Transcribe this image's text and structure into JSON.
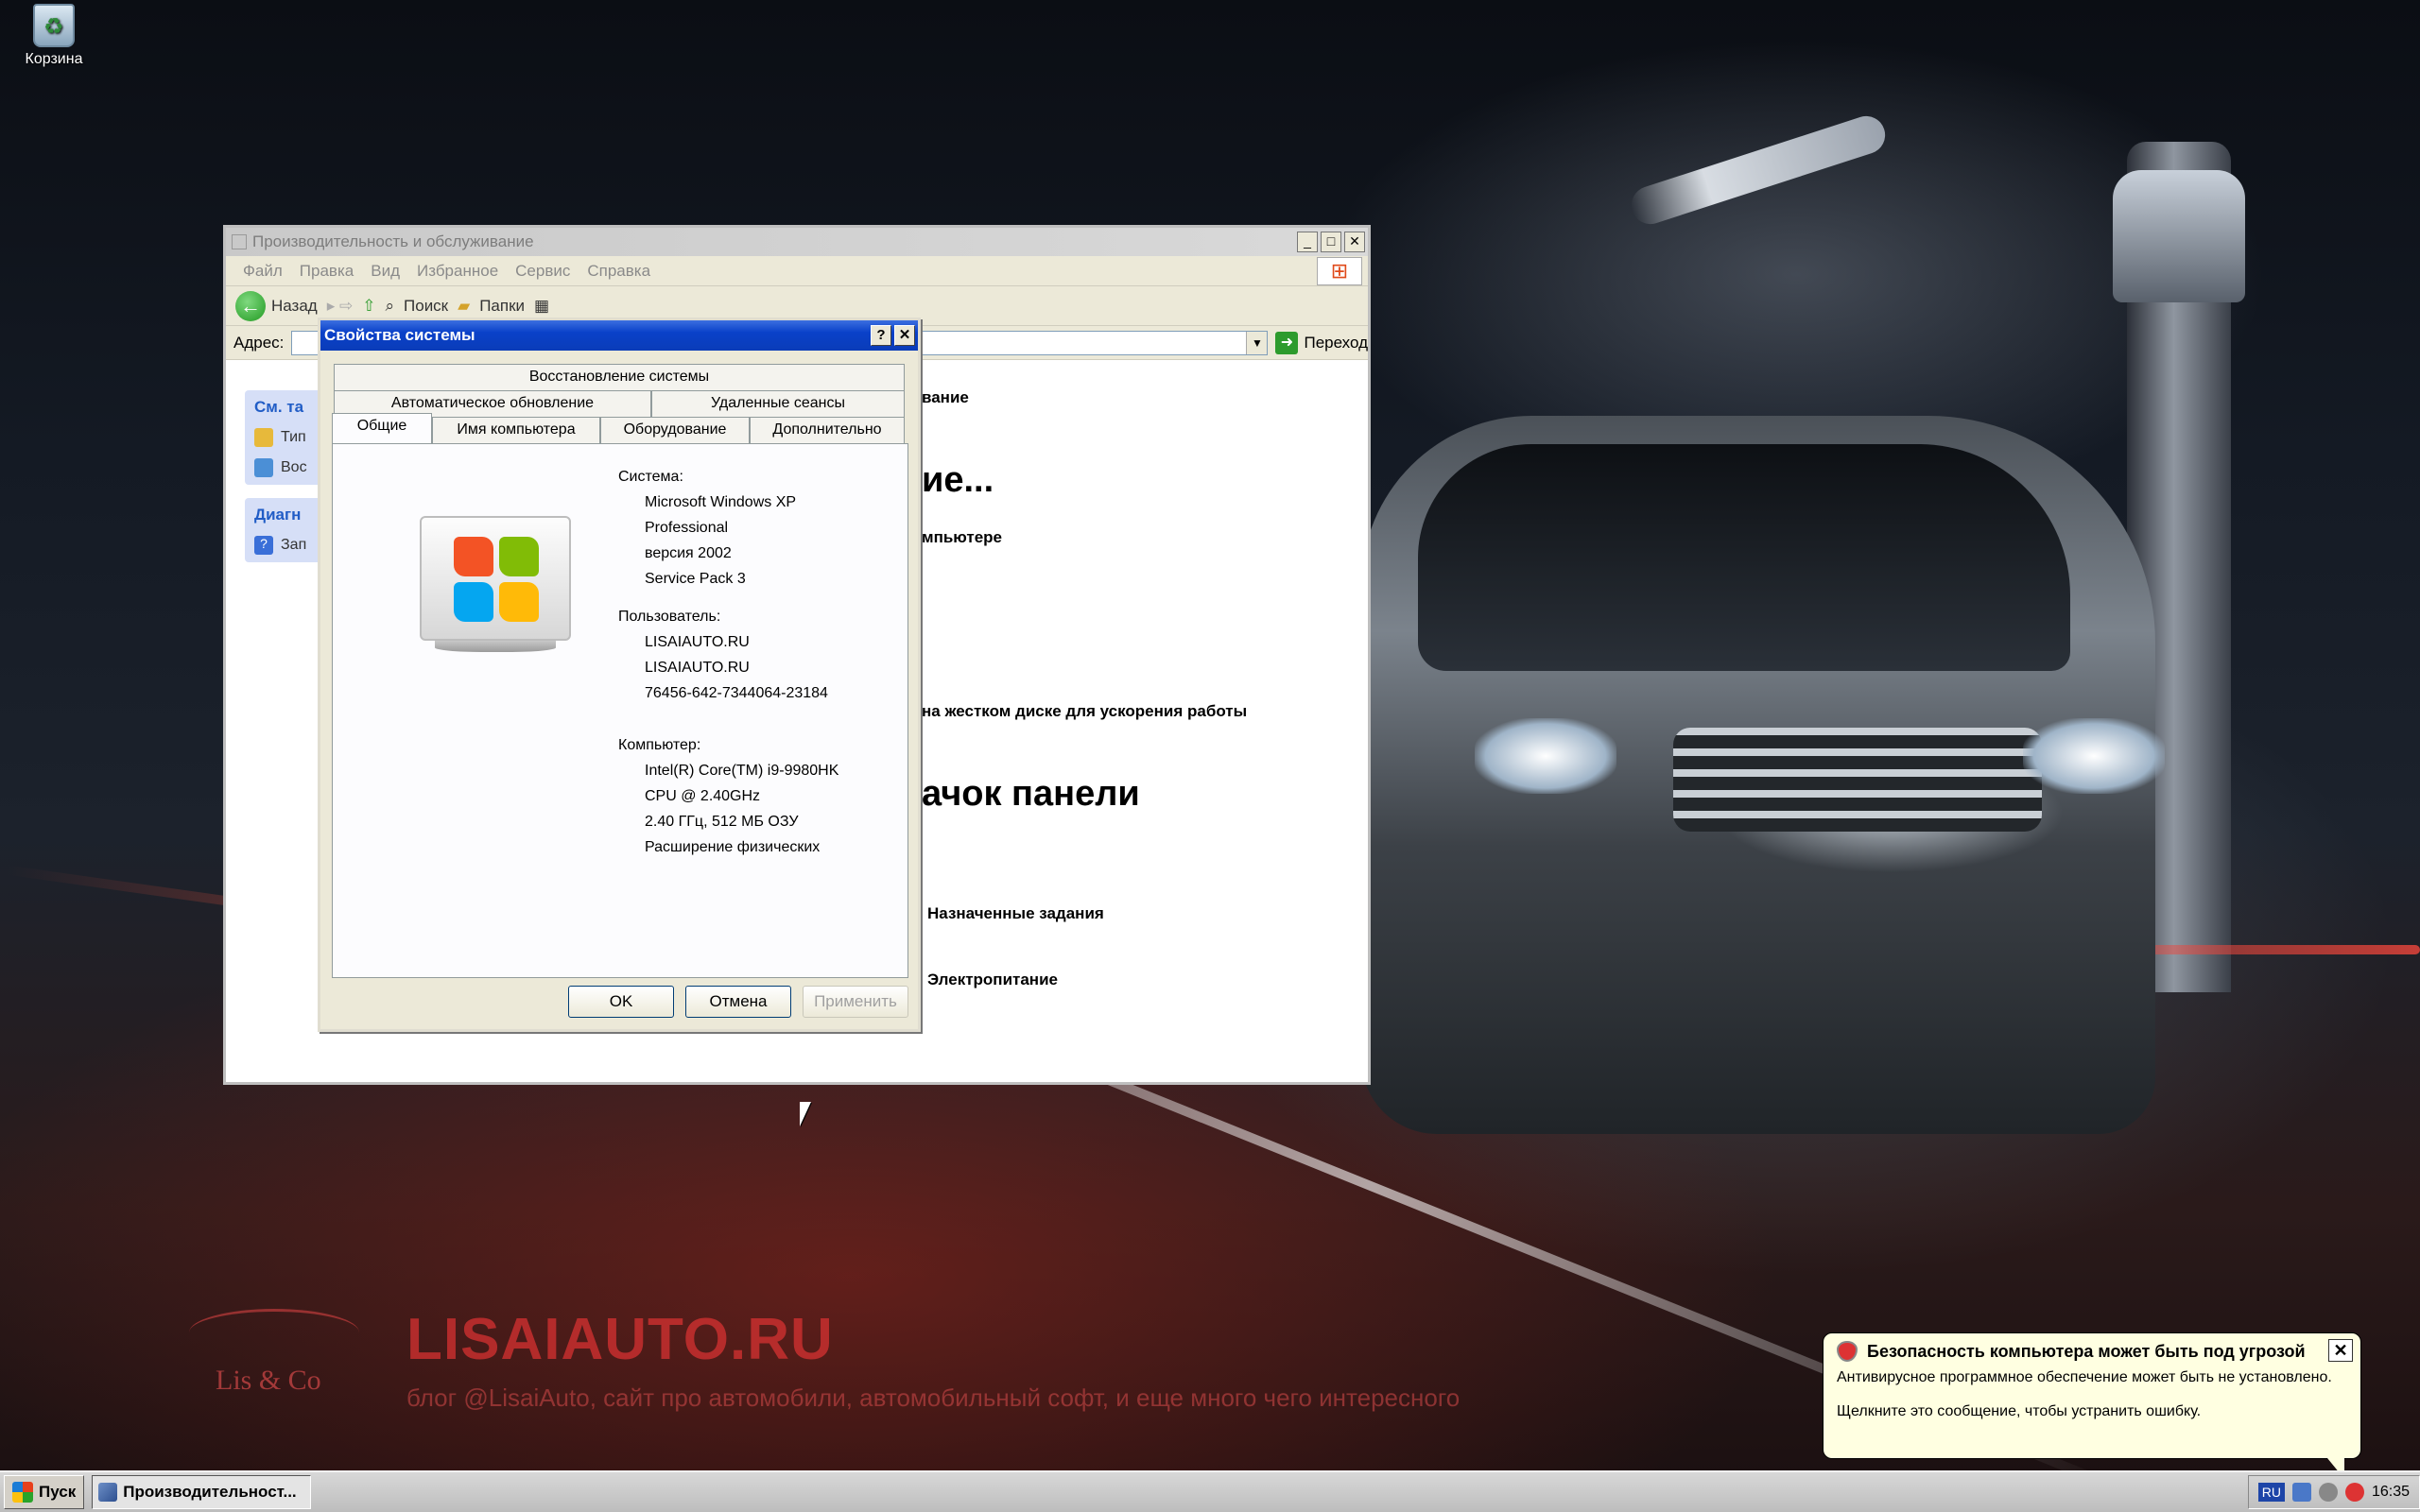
{
  "desktop": {
    "recycle_bin_label": "Корзина",
    "watermark": {
      "logo_text": "Lis & Co",
      "title": "LISAIAUTO.RU",
      "subtitle": "блог @LisaiAuto, сайт про автомобили, автомобильный софт, и еще много чего интересного"
    }
  },
  "explorer": {
    "title": "Производительность и обслуживание",
    "menu": [
      "Файл",
      "Правка",
      "Вид",
      "Избранное",
      "Сервис",
      "Справка"
    ],
    "toolbar": {
      "back": "Назад",
      "search": "Поиск",
      "folders": "Папки"
    },
    "address_label": "Адрес:",
    "go_label": "Переход",
    "side": {
      "see_also_head": "См. та",
      "see_also_items": [
        "Тип",
        "Вос"
      ],
      "diag_head": "Диагн",
      "diag_items": [
        "Зап"
      ]
    },
    "content": {
      "line1": "вание",
      "heading1": "ие...",
      "line2": "мпьютере",
      "line3": "на жестком диске для ускорения работы",
      "heading2": "ачок панели",
      "task1": "Назначенные задания",
      "task2": "Электропитание"
    }
  },
  "dialog": {
    "title": "Свойства системы",
    "help_btn": "?",
    "close_btn": "✕",
    "tabs_row1": [
      "Восстановление системы"
    ],
    "tabs_row2": [
      "Автоматическое обновление",
      "Удаленные сеансы"
    ],
    "tabs_row3": [
      "Общие",
      "Имя компьютера",
      "Оборудование",
      "Дополнительно"
    ],
    "system_label": "Система:",
    "system": [
      "Microsoft Windows XP",
      "Professional",
      "версия 2002",
      "Service Pack 3"
    ],
    "user_label": "Пользователь:",
    "user": [
      "LISAIAUTO.RU",
      "LISAIAUTO.RU",
      "76456-642-7344064-23184"
    ],
    "computer_label": "Компьютер:",
    "computer": [
      "Intel(R) Core(TM) i9-9980HK",
      "CPU @ 2.40GHz",
      "2.40 ГГц, 512 МБ ОЗУ",
      "Расширение физических"
    ],
    "buttons": {
      "ok": "OK",
      "cancel": "Отмена",
      "apply": "Применить"
    }
  },
  "taskbar": {
    "start": "Пуск",
    "task": "Производительност...",
    "lang": "RU",
    "clock": "16:35"
  },
  "balloon": {
    "title": "Безопасность компьютера может быть под угрозой",
    "line1": "Антивирусное программное обеспечение может быть не установлено.",
    "line2": "Щелкните это сообщение, чтобы устранить ошибку."
  }
}
